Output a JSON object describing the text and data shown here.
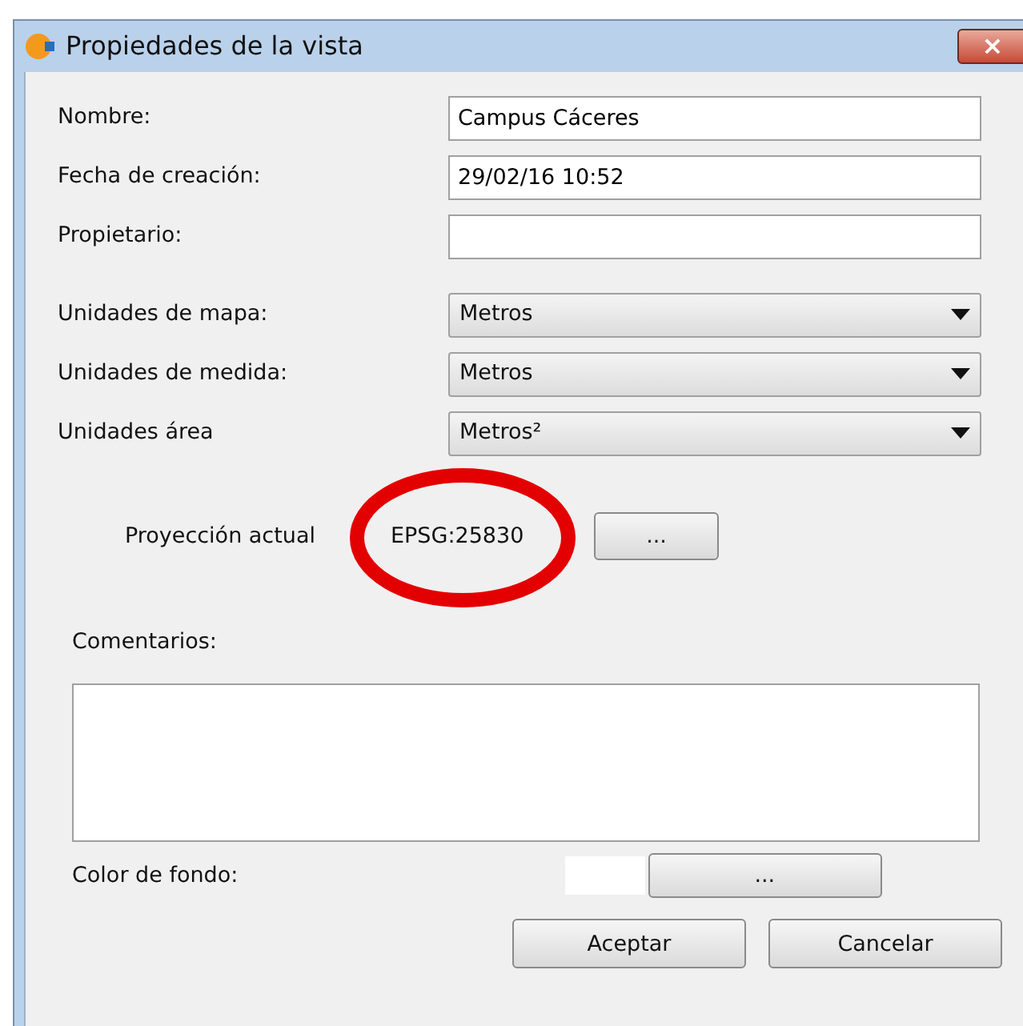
{
  "window": {
    "title": "Propiedades de la vista",
    "close": "×"
  },
  "fields": [
    {
      "kind": "text",
      "label": "Nombre:",
      "value": "Campus Cáceres"
    },
    {
      "kind": "text",
      "label": "Fecha de creación:",
      "value": "29/02/16 10:52"
    },
    {
      "kind": "text",
      "label": "Propietario:"
    },
    {
      "kind": "select",
      "label": "Unidades de mapa:",
      "value": "Metros"
    },
    {
      "kind": "select",
      "label": "Unidades de medida:",
      "value": "Metros"
    },
    {
      "kind": "select",
      "label": "Unidades área",
      "value": "Metros²"
    }
  ],
  "projection": {
    "label": "Proyección actual",
    "value": "EPSG:25830",
    "button": "...",
    "highlighted": true
  },
  "comments": {
    "label": "Comentarios:"
  },
  "background": {
    "label": "Color de fondo:",
    "color": "#ffffff",
    "button": "..."
  },
  "buttons": [
    "Aceptar",
    "Cancelar"
  ]
}
